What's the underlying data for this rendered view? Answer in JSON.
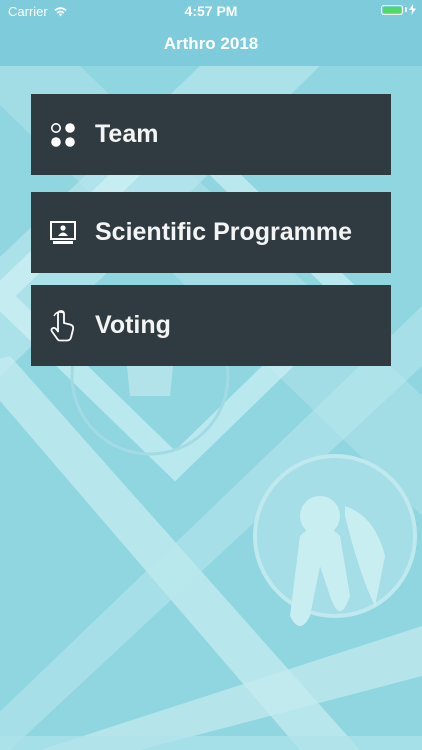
{
  "status_bar": {
    "carrier": "Carrier",
    "time": "4:57 PM"
  },
  "nav": {
    "title": "Arthro 2018"
  },
  "menu": {
    "items": [
      {
        "label": "Team",
        "icon": "team-dots-icon"
      },
      {
        "label": "Scientific Programme",
        "icon": "presentation-screen-icon"
      },
      {
        "label": "Voting",
        "icon": "hand-tap-icon"
      }
    ]
  },
  "colors": {
    "background": "#8fd6e0",
    "bar": "#7dcbdb",
    "menu_item": "#2f3b40",
    "battery": "#4cd964"
  }
}
